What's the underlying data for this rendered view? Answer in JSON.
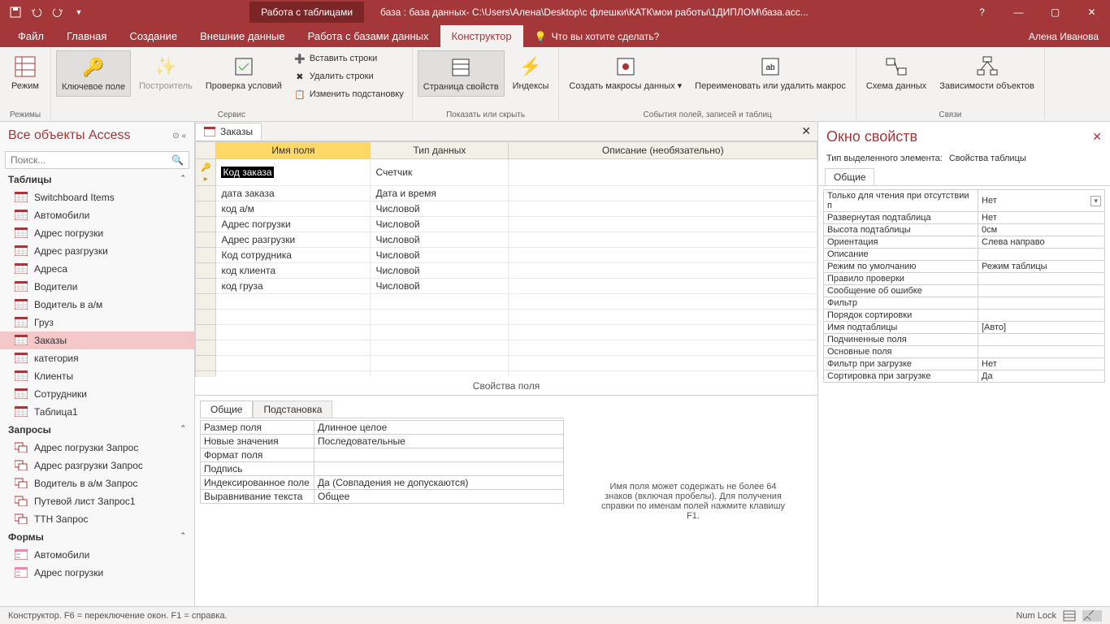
{
  "title": {
    "contextTab": "Работа с таблицами",
    "docTitle": "база : база данных- C:\\Users\\Алена\\Desktop\\с флешки\\КАТК\\мои работы\\1ДИПЛОМ\\база.acc..."
  },
  "tabs": {
    "file": "Файл",
    "home": "Главная",
    "create": "Создание",
    "external": "Внешние данные",
    "dbtools": "Работа с базами данных",
    "design": "Конструктор",
    "tellMe": "Что вы хотите сделать?",
    "user": "Алена Иванова"
  },
  "ribbon": {
    "view": "Режим",
    "viewGroup": "Режимы",
    "primaryKey": "Ключевое поле",
    "builder": "Построитель",
    "validation": "Проверка условий",
    "insertRows": "Вставить строки",
    "deleteRows": "Удалить строки",
    "modifyLookups": "Изменить подстановку",
    "serviceGroup": "Сервис",
    "propSheet": "Страница свойств",
    "indexes": "Индексы",
    "showHideGroup": "Показать или скрыть",
    "createMacros": "Создать макросы данных ▾",
    "renameDelete": "Переименовать или удалить макрос",
    "eventsGroup": "События полей, записей и таблиц",
    "relationships": "Схема данных",
    "dependencies": "Зависимости объектов",
    "relGroup": "Связи"
  },
  "nav": {
    "header": "Все объекты Access",
    "searchPlaceholder": "Поиск...",
    "groups": {
      "tables": "Таблицы",
      "queries": "Запросы",
      "forms": "Формы"
    },
    "tables": [
      "Switchboard Items",
      "Автомобили",
      "Адрес погрузки",
      "Адрес разгрузки",
      "Адреса",
      "Водители",
      "Водитель в а/м",
      "Груз",
      "Заказы",
      "категория",
      "Клиенты",
      "Сотрудники",
      "Таблица1"
    ],
    "queries": [
      "Адрес погрузки Запрос",
      "Адрес разгрузки Запрос",
      "Водитель в а/м Запрос",
      "Путевой лист Запрос1",
      "ТТН Запрос"
    ],
    "forms": [
      "Автомобили",
      "Адрес погрузки"
    ]
  },
  "design": {
    "tabName": "Заказы",
    "columns": {
      "name": "Имя поля",
      "type": "Тип данных",
      "desc": "Описание (необязательно)"
    },
    "fields": [
      {
        "name": "Код заказа",
        "type": "Счетчик",
        "pk": true,
        "current": true
      },
      {
        "name": "дата заказа",
        "type": "Дата и время"
      },
      {
        "name": "код а/м",
        "type": "Числовой"
      },
      {
        "name": "Адрес погрузки",
        "type": "Числовой"
      },
      {
        "name": "Адрес разгрузки",
        "type": "Числовой"
      },
      {
        "name": "Код сотрудника",
        "type": "Числовой"
      },
      {
        "name": "код клиента",
        "type": "Числовой"
      },
      {
        "name": "код груза",
        "type": "Числовой"
      }
    ],
    "propsLabel": "Свойства поля",
    "propsTabs": {
      "general": "Общие",
      "lookup": "Подстановка"
    },
    "props": [
      {
        "k": "Размер поля",
        "v": "Длинное целое"
      },
      {
        "k": "Новые значения",
        "v": "Последовательные"
      },
      {
        "k": "Формат поля",
        "v": ""
      },
      {
        "k": "Подпись",
        "v": ""
      },
      {
        "k": "Индексированное поле",
        "v": "Да (Совпадения не допускаются)"
      },
      {
        "k": "Выравнивание текста",
        "v": "Общее"
      }
    ],
    "helpText": "Имя поля может содержать не более 64 знаков (включая пробелы). Для получения справки по именам полей нажмите клавишу F1."
  },
  "propSheet": {
    "title": "Окно свойств",
    "subLabel": "Тип выделенного элемента:",
    "subValue": "Свойства таблицы",
    "tab": "Общие",
    "rows": [
      {
        "k": "Только для чтения при отсутствии п",
        "v": "Нет",
        "dd": true
      },
      {
        "k": "Развернутая подтаблица",
        "v": "Нет"
      },
      {
        "k": "Высота подтаблицы",
        "v": "0см"
      },
      {
        "k": "Ориентация",
        "v": "Слева направо"
      },
      {
        "k": "Описание",
        "v": ""
      },
      {
        "k": "Режим по умолчанию",
        "v": "Режим таблицы"
      },
      {
        "k": "Правило проверки",
        "v": ""
      },
      {
        "k": "Сообщение об ошибке",
        "v": ""
      },
      {
        "k": "Фильтр",
        "v": ""
      },
      {
        "k": "Порядок сортировки",
        "v": ""
      },
      {
        "k": "Имя подтаблицы",
        "v": "[Авто]"
      },
      {
        "k": "Подчиненные поля",
        "v": ""
      },
      {
        "k": "Основные поля",
        "v": ""
      },
      {
        "k": "Фильтр при загрузке",
        "v": "Нет"
      },
      {
        "k": "Сортировка при загрузке",
        "v": "Да"
      }
    ]
  },
  "statusbar": {
    "left": "Конструктор.  F6 = переключение окон.  F1 = справка.",
    "numlock": "Num Lock"
  }
}
